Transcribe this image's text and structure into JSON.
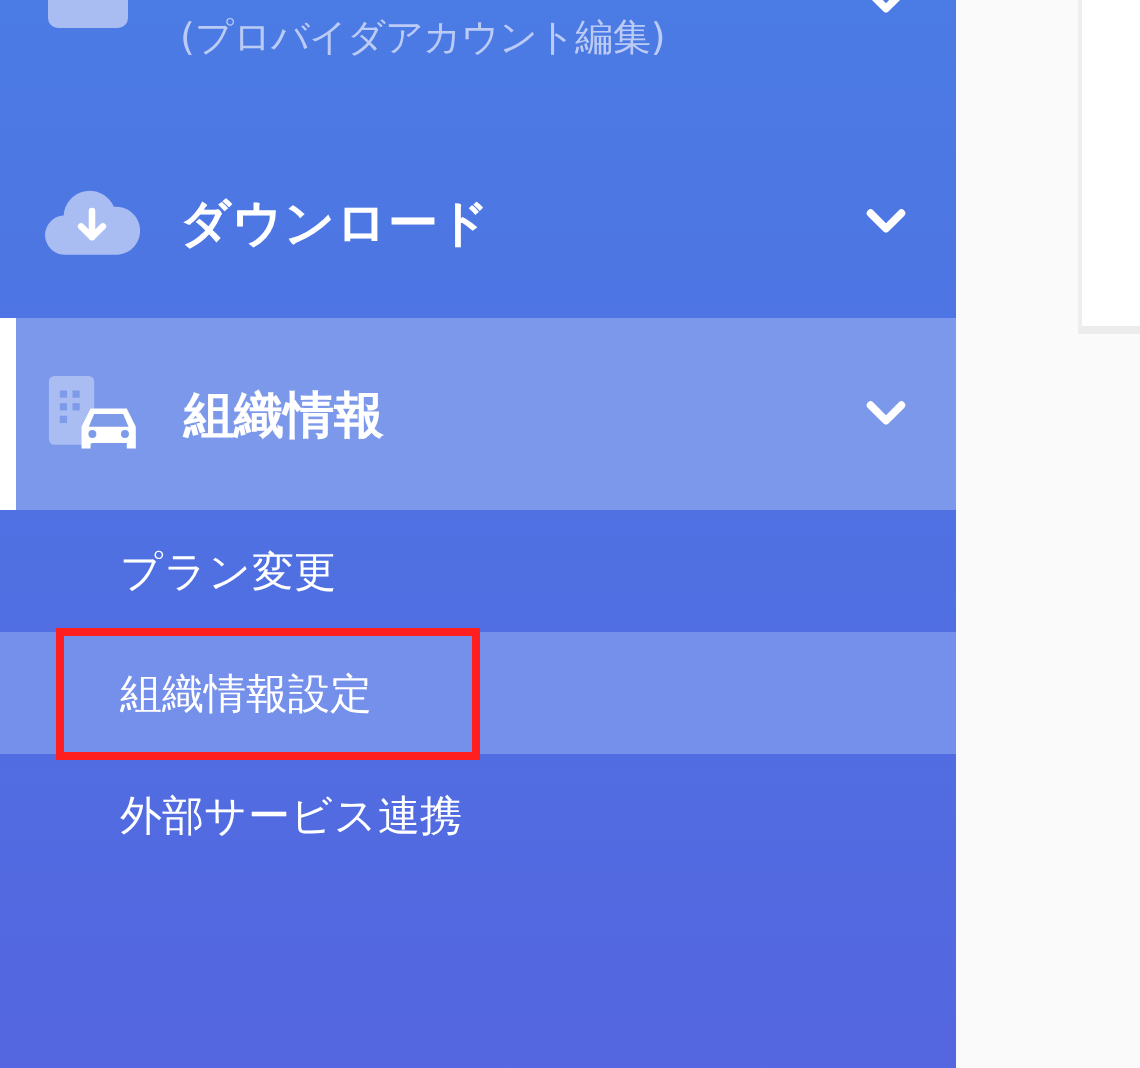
{
  "sidebar": {
    "items": [
      {
        "kind": "partial",
        "subtitle": "(プロバイダアカウント編集)",
        "selected": false
      },
      {
        "kind": "menu",
        "label": "ダウンロード",
        "selected": false
      },
      {
        "kind": "menu",
        "label": "組織情報",
        "selected": true,
        "children": [
          {
            "label": "プラン変更",
            "selected": false,
            "annotated": false
          },
          {
            "label": "組織情報設定",
            "selected": true,
            "annotated": true
          },
          {
            "label": "外部サービス連携",
            "selected": false,
            "annotated": false
          }
        ]
      }
    ]
  }
}
